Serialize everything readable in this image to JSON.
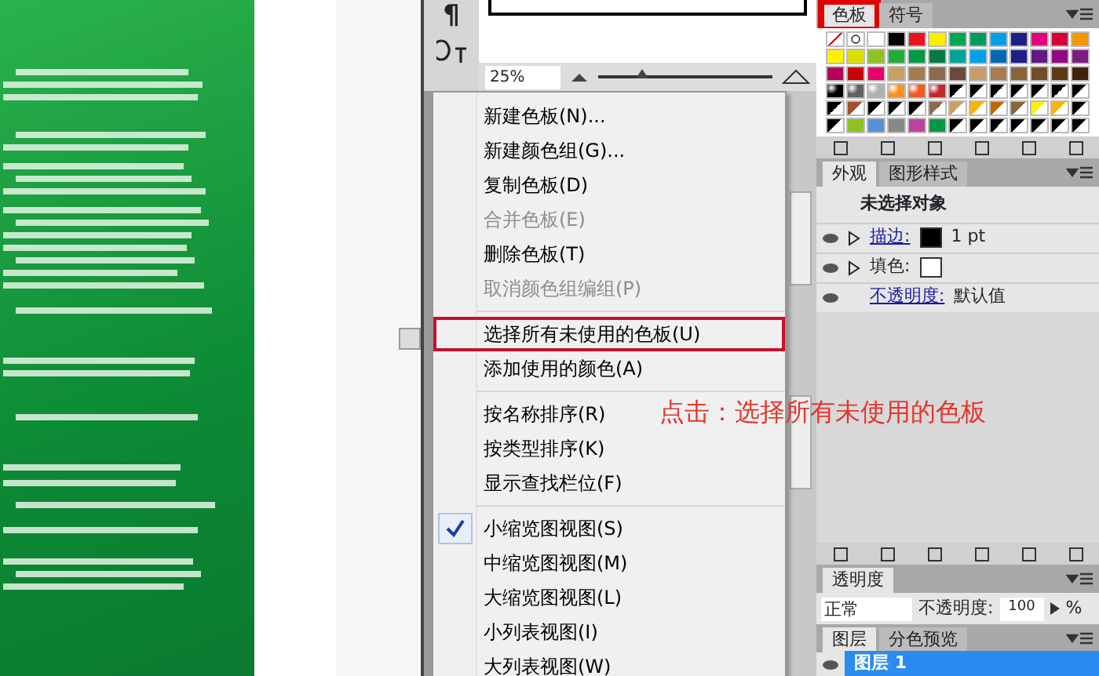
{
  "tool_strip": {
    "paragraph_glyph": "¶"
  },
  "navigator": {
    "zoom": "25%",
    "level": 0.25
  },
  "menu": {
    "items": [
      {
        "kind": "item",
        "label": "新建色板(N)...",
        "disabled": false,
        "checked": false,
        "highlighted": false
      },
      {
        "kind": "item",
        "label": "新建颜色组(G)...",
        "disabled": false,
        "checked": false,
        "highlighted": false
      },
      {
        "kind": "item",
        "label": "复制色板(D)",
        "disabled": false,
        "checked": false,
        "highlighted": false
      },
      {
        "kind": "item",
        "label": "合并色板(E)",
        "disabled": true,
        "checked": false,
        "highlighted": false
      },
      {
        "kind": "item",
        "label": "删除色板(T)",
        "disabled": false,
        "checked": false,
        "highlighted": false
      },
      {
        "kind": "item",
        "label": "取消颜色组编组(P)",
        "disabled": true,
        "checked": false,
        "highlighted": false
      },
      {
        "kind": "separator"
      },
      {
        "kind": "item",
        "label": "选择所有未使用的色板(U)",
        "disabled": false,
        "checked": false,
        "highlighted": true
      },
      {
        "kind": "item",
        "label": "添加使用的颜色(A)",
        "disabled": false,
        "checked": false,
        "highlighted": false
      },
      {
        "kind": "separator"
      },
      {
        "kind": "item",
        "label": "按名称排序(R)",
        "disabled": false,
        "checked": false,
        "highlighted": false
      },
      {
        "kind": "item",
        "label": "按类型排序(K)",
        "disabled": false,
        "checked": false,
        "highlighted": false
      },
      {
        "kind": "item",
        "label": "显示查找栏位(F)",
        "disabled": false,
        "checked": false,
        "highlighted": false
      },
      {
        "kind": "separator"
      },
      {
        "kind": "item",
        "label": "小缩览图视图(S)",
        "disabled": false,
        "checked": true,
        "highlighted": false
      },
      {
        "kind": "item",
        "label": "中缩览图视图(M)",
        "disabled": false,
        "checked": false,
        "highlighted": false
      },
      {
        "kind": "item",
        "label": "大缩览图视图(L)",
        "disabled": false,
        "checked": false,
        "highlighted": false
      },
      {
        "kind": "item",
        "label": "小列表视图(I)",
        "disabled": false,
        "checked": false,
        "highlighted": false
      },
      {
        "kind": "item",
        "label": "大列表视图(W)",
        "disabled": false,
        "checked": false,
        "highlighted": false
      }
    ]
  },
  "annotation": "点击：选择所有未使用的色板",
  "swatches_panel": {
    "tabs": [
      {
        "label": "色板",
        "selected": true,
        "highlighted": true
      },
      {
        "label": "符号",
        "selected": false,
        "highlighted": false
      }
    ],
    "swatch_rows": [
      [
        {
          "kind": "none",
          "color": "#ffffff"
        },
        {
          "kind": "registration",
          "color": "#ffffff"
        },
        {
          "kind": "solid",
          "color": "#ffffff"
        },
        {
          "kind": "solid",
          "color": "#000000"
        },
        {
          "kind": "solid",
          "color": "#e8141b"
        },
        {
          "kind": "solid",
          "color": "#ffed00"
        },
        {
          "kind": "solid",
          "color": "#00a651"
        },
        {
          "kind": "solid",
          "color": "#009a5e"
        },
        {
          "kind": "solid",
          "color": "#00a0e9"
        },
        {
          "kind": "solid",
          "color": "#1d2088"
        },
        {
          "kind": "solid",
          "color": "#e4007f"
        },
        {
          "kind": "solid",
          "color": "#d7003a"
        },
        {
          "kind": "solid",
          "color": "#f39800"
        }
      ],
      [
        {
          "kind": "solid",
          "color": "#fff100"
        },
        {
          "kind": "solid",
          "color": "#d7e000"
        },
        {
          "kind": "solid",
          "color": "#8fc31f"
        },
        {
          "kind": "solid",
          "color": "#22ac38"
        },
        {
          "kind": "solid",
          "color": "#009944"
        },
        {
          "kind": "solid",
          "color": "#007b43"
        },
        {
          "kind": "solid",
          "color": "#00a497"
        },
        {
          "kind": "solid",
          "color": "#00a0e9"
        },
        {
          "kind": "solid",
          "color": "#0068b7"
        },
        {
          "kind": "solid",
          "color": "#1d2088"
        },
        {
          "kind": "solid",
          "color": "#601986"
        },
        {
          "kind": "solid",
          "color": "#920783"
        },
        {
          "kind": "solid",
          "color": "#7d1c82"
        }
      ],
      [
        {
          "kind": "solid",
          "color": "#b5005b"
        },
        {
          "kind": "solid",
          "color": "#c7000b"
        },
        {
          "kind": "solid",
          "color": "#e5006a"
        },
        {
          "kind": "solid",
          "color": "#c9a063"
        },
        {
          "kind": "solid",
          "color": "#a57c52"
        },
        {
          "kind": "solid",
          "color": "#8b6a4e"
        },
        {
          "kind": "solid",
          "color": "#6a4a3c"
        },
        {
          "kind": "solid",
          "color": "#c69c6d"
        },
        {
          "kind": "solid",
          "color": "#a67c52"
        },
        {
          "kind": "solid",
          "color": "#8c6239"
        },
        {
          "kind": "solid",
          "color": "#754c24"
        },
        {
          "kind": "solid",
          "color": "#603913"
        },
        {
          "kind": "solid",
          "color": "#42210b"
        }
      ],
      [
        {
          "kind": "gradient",
          "color": "#000000"
        },
        {
          "kind": "gradient",
          "color": "#606060"
        },
        {
          "kind": "gradient",
          "color": "#b0b0b0"
        },
        {
          "kind": "gradient",
          "color": "#f7931e"
        },
        {
          "kind": "gradient",
          "color": "#f15a24"
        },
        {
          "kind": "gradient",
          "color": "#c1272d"
        },
        {
          "kind": "pattern",
          "color": "#000000"
        },
        {
          "kind": "pattern",
          "color": "#000000"
        },
        {
          "kind": "pattern",
          "color": "#000000"
        },
        {
          "kind": "pattern",
          "color": "#000000"
        },
        {
          "kind": "pattern",
          "color": "#000000"
        },
        {
          "kind": "pattern",
          "color": "#000000"
        },
        {
          "kind": "pattern",
          "color": "#000000"
        }
      ],
      [
        {
          "kind": "pattern",
          "color": "#000000"
        },
        {
          "kind": "pattern",
          "color": "#a0522d"
        },
        {
          "kind": "pattern",
          "color": "#000000"
        },
        {
          "kind": "pattern",
          "color": "#000000"
        },
        {
          "kind": "pattern",
          "color": "#000000"
        },
        {
          "kind": "pattern",
          "color": "#8b6a4e"
        },
        {
          "kind": "pattern",
          "color": "#c9a063"
        },
        {
          "kind": "pattern",
          "color": "#f7b500"
        },
        {
          "kind": "pattern",
          "color": "#c86400"
        },
        {
          "kind": "pattern",
          "color": "#8c6239"
        },
        {
          "kind": "pattern",
          "color": "#fff100"
        },
        {
          "kind": "pattern",
          "color": "#f7b500"
        },
        {
          "kind": "pattern",
          "color": "#000000"
        }
      ],
      [
        {
          "kind": "pattern",
          "color": "#000000"
        },
        {
          "kind": "solid",
          "color": "#8fc31f"
        },
        {
          "kind": "solid",
          "color": "#5b8fd6"
        },
        {
          "kind": "solid",
          "color": "#888888"
        },
        {
          "kind": "solid",
          "color": "#c040a0"
        },
        {
          "kind": "solid",
          "color": "#009944"
        },
        {
          "kind": "pattern",
          "color": "#000000"
        },
        {
          "kind": "pattern",
          "color": "#000000"
        },
        {
          "kind": "pattern",
          "color": "#000000"
        },
        {
          "kind": "pattern",
          "color": "#000000"
        },
        {
          "kind": "pattern",
          "color": "#000000"
        },
        {
          "kind": "pattern",
          "color": "#000000"
        },
        {
          "kind": "pattern",
          "color": "#000000"
        }
      ]
    ]
  },
  "appearance_panel": {
    "tabs": [
      {
        "label": "外观",
        "selected": true
      },
      {
        "label": "图形样式",
        "selected": false
      }
    ],
    "title": "未选择对象",
    "rows": [
      {
        "kind": "stroke",
        "label": "描边:",
        "link": true,
        "color": "#000000",
        "value": "1 pt"
      },
      {
        "kind": "fill",
        "label": "填色:",
        "link": false,
        "color": "#ffffff"
      },
      {
        "kind": "opacity",
        "label": "不透明度:",
        "link": true,
        "value": "默认值"
      }
    ]
  },
  "transparency_panel": {
    "tab": "透明度",
    "blend_mode": "正常",
    "opacity_label": "不透明度:",
    "opacity_value": "100",
    "unit": "%"
  },
  "layers_panel": {
    "tabs": [
      {
        "label": "图层",
        "selected": true
      },
      {
        "label": "分色预览",
        "selected": false
      }
    ],
    "layers": [
      {
        "name": "图层 1",
        "selected": true
      }
    ]
  }
}
